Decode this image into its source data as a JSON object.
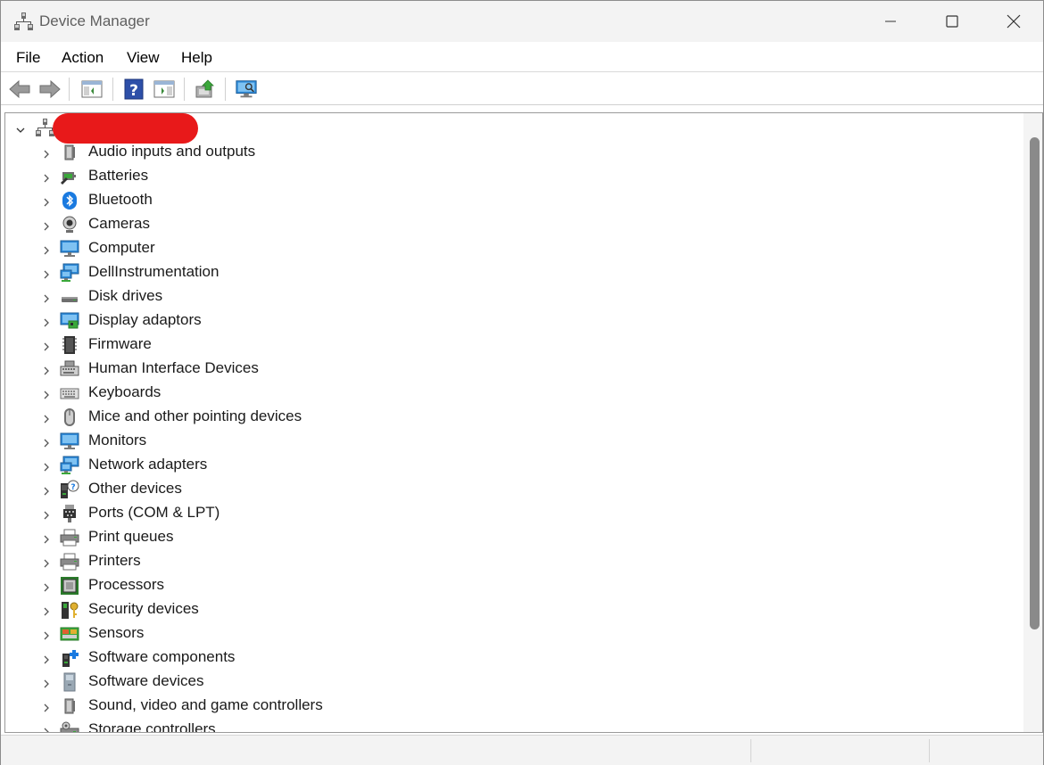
{
  "window": {
    "title": "Device Manager",
    "icon": "device-manager-icon"
  },
  "menu": {
    "items": [
      "File",
      "Action",
      "View",
      "Help"
    ]
  },
  "toolbar": {
    "buttons": [
      "back-arrow-icon",
      "forward-arrow-icon",
      "show-hide-console-tree-icon",
      "help-icon",
      "properties-icon",
      "update-driver-icon",
      "scan-hardware-icon"
    ]
  },
  "tree": {
    "root": {
      "label": "",
      "icon": "computer-network-icon",
      "expanded": true
    },
    "categories": [
      {
        "label": "Audio inputs and outputs",
        "icon": "speaker-icon"
      },
      {
        "label": "Batteries",
        "icon": "battery-icon"
      },
      {
        "label": "Bluetooth",
        "icon": "bluetooth-icon"
      },
      {
        "label": "Cameras",
        "icon": "camera-icon"
      },
      {
        "label": "Computer",
        "icon": "monitor-icon"
      },
      {
        "label": "DellInstrumentation",
        "icon": "network-monitor-icon"
      },
      {
        "label": "Disk drives",
        "icon": "disk-drive-icon"
      },
      {
        "label": "Display adaptors",
        "icon": "display-adapter-icon"
      },
      {
        "label": "Firmware",
        "icon": "chip-icon"
      },
      {
        "label": "Human Interface Devices",
        "icon": "hid-icon"
      },
      {
        "label": "Keyboards",
        "icon": "keyboard-icon"
      },
      {
        "label": "Mice and other pointing devices",
        "icon": "mouse-icon"
      },
      {
        "label": "Monitors",
        "icon": "monitor-icon"
      },
      {
        "label": "Network adapters",
        "icon": "network-monitor-icon"
      },
      {
        "label": "Other devices",
        "icon": "unknown-device-icon"
      },
      {
        "label": "Ports (COM & LPT)",
        "icon": "port-icon"
      },
      {
        "label": "Print queues",
        "icon": "printer-icon"
      },
      {
        "label": "Printers",
        "icon": "printer-icon"
      },
      {
        "label": "Processors",
        "icon": "processor-icon"
      },
      {
        "label": "Security devices",
        "icon": "security-key-icon"
      },
      {
        "label": "Sensors",
        "icon": "sensor-icon"
      },
      {
        "label": "Software components",
        "icon": "software-component-icon"
      },
      {
        "label": "Software devices",
        "icon": "software-device-icon"
      },
      {
        "label": "Sound, video and game controllers",
        "icon": "speaker-icon"
      },
      {
        "label": "Storage controllers",
        "icon": "storage-controller-icon"
      }
    ]
  },
  "colors": {
    "redaction": "#e8191a",
    "scroll_thumb": "#8a8a8a"
  }
}
